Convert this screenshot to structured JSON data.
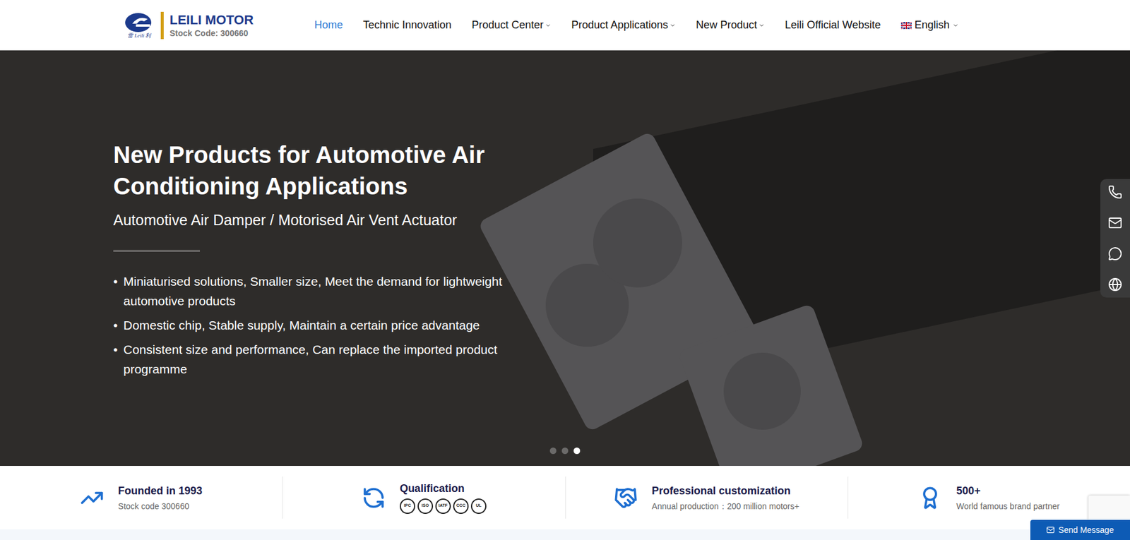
{
  "header": {
    "logo": {
      "name": "LEILI MOTOR",
      "stock": "Stock Code: 300660",
      "script": "雷 Leili 利"
    },
    "nav": [
      {
        "label": "Home",
        "selected": true,
        "dropdown": false
      },
      {
        "label": "Technic Innovation",
        "selected": false,
        "dropdown": false
      },
      {
        "label": "Product Center",
        "selected": false,
        "dropdown": true
      },
      {
        "label": "Product Applications",
        "selected": false,
        "dropdown": true
      },
      {
        "label": "New Product",
        "selected": false,
        "dropdown": true
      },
      {
        "label": "Leili Official Website",
        "selected": false,
        "dropdown": false
      }
    ],
    "language": {
      "label": "English",
      "dropdown": true
    }
  },
  "hero": {
    "title_lines": [
      "New Products for Automotive Air",
      "Conditioning Applications"
    ],
    "subtitle": "Automotive Air Damper / Motorised Air Vent Actuator",
    "bullets": [
      "Miniaturised solutions, Smaller size, Meet the demand for lightweight automotive products",
      "Domestic chip, Stable supply, Maintain a certain price advantage",
      "Consistent size and performance, Can replace the imported product programme"
    ],
    "dots": [
      {
        "selected": false
      },
      {
        "selected": false
      },
      {
        "selected": true
      }
    ]
  },
  "stats": [
    {
      "kind": "growth",
      "title": "Founded in 1993",
      "subtitle": "Stock code 300660"
    },
    {
      "kind": "certs",
      "title": "Qualification",
      "certs": [
        "IPC",
        "ISO",
        "IATF",
        "CCC",
        "UL"
      ]
    },
    {
      "kind": "handshake",
      "title": "Professional customization",
      "subtitle": "Annual production：200 million motors+"
    },
    {
      "kind": "award",
      "title": "500+",
      "subtitle": "World famous brand partner"
    }
  ],
  "send_message": "Send Message"
}
